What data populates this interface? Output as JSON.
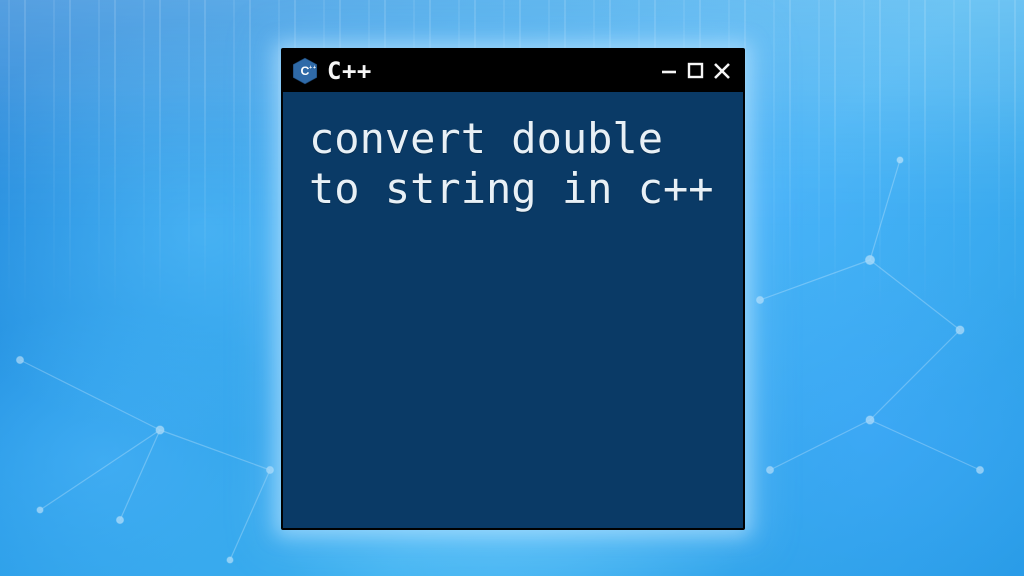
{
  "window": {
    "title": "C++",
    "content": "convert double to string in c++"
  },
  "icons": {
    "logo": "cpp-logo",
    "minimize": "minimize-icon",
    "maximize": "maximize-icon",
    "close": "close-icon"
  },
  "colors": {
    "window_bg": "#0a3a66",
    "titlebar_bg": "#000000",
    "text": "#e8f0f6",
    "background_primary": "#2a9ce8",
    "logo_fill": "#2f6aa8"
  }
}
